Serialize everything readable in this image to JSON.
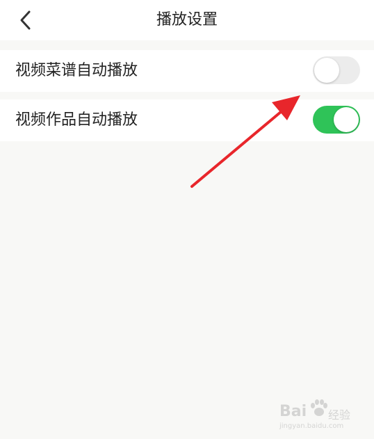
{
  "header": {
    "title": "播放设置",
    "back_icon": "chevron-left-icon"
  },
  "settings": [
    {
      "label": "视频菜谱自动播放",
      "enabled": false
    },
    {
      "label": "视频作品自动播放",
      "enabled": true
    }
  ],
  "colors": {
    "toggle_on": "#2fc358",
    "toggle_off": "#ececec",
    "arrow": "#e8262b",
    "background": "#f8f8f6"
  },
  "watermark": {
    "brand": "Bai",
    "sub": "经验",
    "url": "jingyan.baidu.com"
  }
}
